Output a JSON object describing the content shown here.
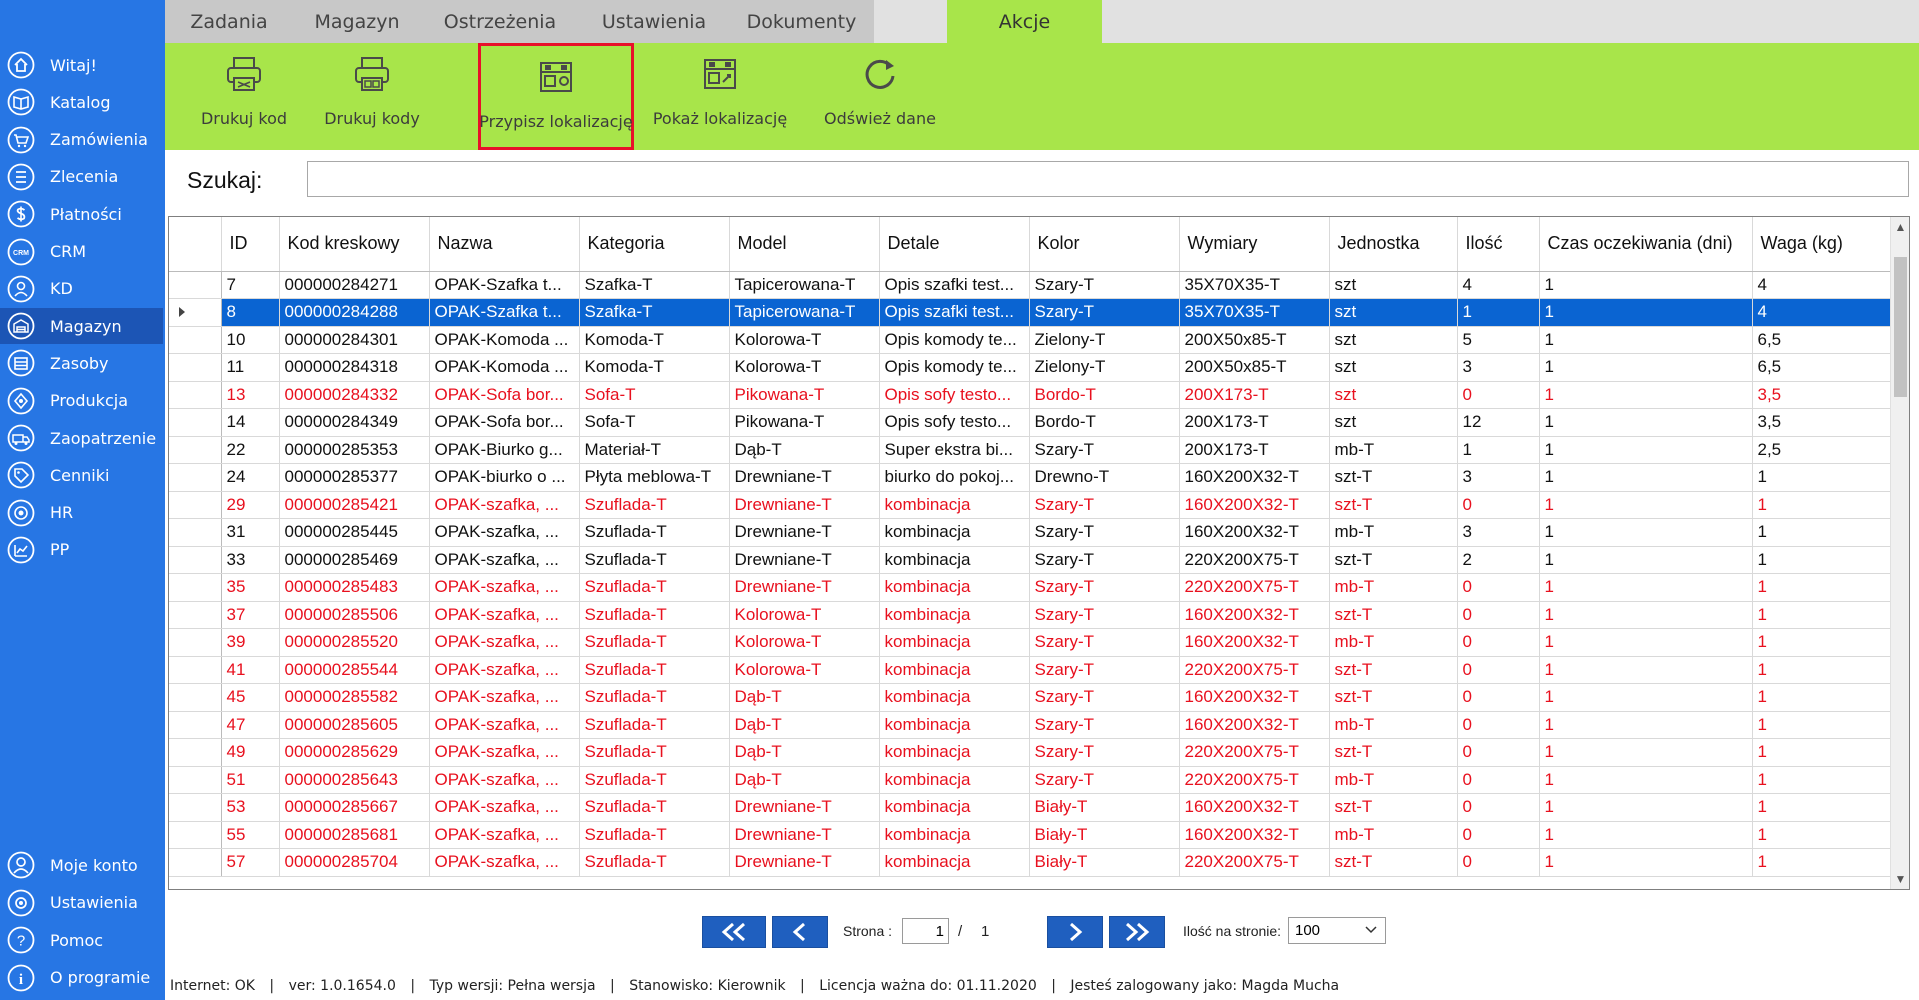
{
  "sidebar": {
    "items": [
      {
        "label": "Witaj!",
        "icon": "home-icon"
      },
      {
        "label": "Katalog",
        "icon": "book-icon"
      },
      {
        "label": "Zamówienia",
        "icon": "cart-icon"
      },
      {
        "label": "Zlecenia",
        "icon": "list-icon"
      },
      {
        "label": "Płatności",
        "icon": "dollar-icon"
      },
      {
        "label": "CRM",
        "icon": "crm-icon"
      },
      {
        "label": "KD",
        "icon": "user-icon"
      },
      {
        "label": "Magazyn",
        "icon": "warehouse-icon"
      },
      {
        "label": "Zasoby",
        "icon": "resources-icon"
      },
      {
        "label": "Produkcja",
        "icon": "production-icon"
      },
      {
        "label": "Zaopatrzenie",
        "icon": "truck-icon"
      },
      {
        "label": "Cenniki",
        "icon": "tag-icon"
      },
      {
        "label": "HR",
        "icon": "hr-icon"
      },
      {
        "label": "PP",
        "icon": "chart-icon"
      }
    ],
    "active_index": 7,
    "bottom_items": [
      {
        "label": "Moje konto",
        "icon": "account-icon"
      },
      {
        "label": "Ustawienia",
        "icon": "gear-icon"
      },
      {
        "label": "Pomoc",
        "icon": "help-icon"
      },
      {
        "label": "O programie",
        "icon": "info-icon"
      }
    ]
  },
  "tabs": [
    "Zadania",
    "Magazyn",
    "Ostrzeżenia",
    "Ustawienia",
    "Dokumenty",
    "Akcje"
  ],
  "active_tab": "Akcje",
  "ribbon": {
    "buttons": [
      {
        "label": "Drukuj kod",
        "icon": "printer-icon"
      },
      {
        "label": "Drukuj kody",
        "icon": "printer-multi-icon"
      },
      {
        "label": "Przypisz lokalizację",
        "icon": "assign-location-icon",
        "highlighted": true
      },
      {
        "label": "Pokaż lokalizację",
        "icon": "show-location-icon"
      },
      {
        "label": "Odśwież dane",
        "icon": "refresh-icon"
      }
    ]
  },
  "search": {
    "label": "Szukaj:",
    "value": ""
  },
  "grid": {
    "columns": [
      "ID",
      "Kod kreskowy",
      "Nazwa",
      "Kategoria",
      "Model",
      "Detale",
      "Kolor",
      "Wymiary",
      "Jednostka",
      "Ilość",
      "Czas oczekiwania (dni)",
      "Waga (kg)"
    ],
    "rows": [
      {
        "id": "7",
        "kod": "000000284271",
        "nazwa": "OPAK-Szafka t...",
        "kategoria": "Szafka-T",
        "model": "Tapicerowana-T",
        "detale": "Opis szafki test...",
        "kolor": "Szary-T",
        "wymiary": "35X70X35-T",
        "jednostka": "szt",
        "ilosc": "4",
        "czas": "1",
        "waga": "4",
        "state": "normal"
      },
      {
        "id": "8",
        "kod": "000000284288",
        "nazwa": "OPAK-Szafka t...",
        "kategoria": "Szafka-T",
        "model": "Tapicerowana-T",
        "detale": "Opis szafki test...",
        "kolor": "Szary-T",
        "wymiary": "35X70X35-T",
        "jednostka": "szt",
        "ilosc": "1",
        "czas": "1",
        "waga": "4",
        "state": "selected"
      },
      {
        "id": "10",
        "kod": "000000284301",
        "nazwa": "OPAK-Komoda ...",
        "kategoria": "Komoda-T",
        "model": "Kolorowa-T",
        "detale": "Opis komody te...",
        "kolor": "Zielony-T",
        "wymiary": "200X50x85-T",
        "jednostka": "szt",
        "ilosc": "5",
        "czas": "1",
        "waga": "6,5",
        "state": "normal"
      },
      {
        "id": "11",
        "kod": "000000284318",
        "nazwa": "OPAK-Komoda ...",
        "kategoria": "Komoda-T",
        "model": "Kolorowa-T",
        "detale": "Opis komody te...",
        "kolor": "Zielony-T",
        "wymiary": "200X50x85-T",
        "jednostka": "szt",
        "ilosc": "3",
        "czas": "1",
        "waga": "6,5",
        "state": "normal"
      },
      {
        "id": "13",
        "kod": "000000284332",
        "nazwa": "OPAK-Sofa bor...",
        "kategoria": "Sofa-T",
        "model": "Pikowana-T",
        "detale": "Opis sofy testo...",
        "kolor": "Bordo-T",
        "wymiary": "200X173-T",
        "jednostka": "szt",
        "ilosc": "0",
        "czas": "1",
        "waga": "3,5",
        "state": "alert"
      },
      {
        "id": "14",
        "kod": "000000284349",
        "nazwa": "OPAK-Sofa bor...",
        "kategoria": "Sofa-T",
        "model": "Pikowana-T",
        "detale": "Opis sofy testo...",
        "kolor": "Bordo-T",
        "wymiary": "200X173-T",
        "jednostka": "szt",
        "ilosc": "12",
        "czas": "1",
        "waga": "3,5",
        "state": "normal"
      },
      {
        "id": "22",
        "kod": "000000285353",
        "nazwa": "OPAK-Biurko g...",
        "kategoria": "Materiał-T",
        "model": "Dąb-T",
        "detale": "Super ekstra bi...",
        "kolor": "Szary-T",
        "wymiary": "200X173-T",
        "jednostka": "mb-T",
        "ilosc": "1",
        "czas": "1",
        "waga": "2,5",
        "state": "normal"
      },
      {
        "id": "24",
        "kod": "000000285377",
        "nazwa": "OPAK-biurko o ...",
        "kategoria": "Płyta meblowa-T",
        "model": "Drewniane-T",
        "detale": "biurko do pokoj...",
        "kolor": "Drewno-T",
        "wymiary": "160X200X32-T",
        "jednostka": "szt-T",
        "ilosc": "3",
        "czas": "1",
        "waga": "1",
        "state": "normal"
      },
      {
        "id": "29",
        "kod": "000000285421",
        "nazwa": "OPAK-szafka, ...",
        "kategoria": "Szuflada-T",
        "model": "Drewniane-T",
        "detale": "kombinacja",
        "kolor": "Szary-T",
        "wymiary": "160X200X32-T",
        "jednostka": "szt-T",
        "ilosc": "0",
        "czas": "1",
        "waga": "1",
        "state": "alert"
      },
      {
        "id": "31",
        "kod": "000000285445",
        "nazwa": "OPAK-szafka, ...",
        "kategoria": "Szuflada-T",
        "model": "Drewniane-T",
        "detale": "kombinacja",
        "kolor": "Szary-T",
        "wymiary": "160X200X32-T",
        "jednostka": "mb-T",
        "ilosc": "3",
        "czas": "1",
        "waga": "1",
        "state": "normal"
      },
      {
        "id": "33",
        "kod": "000000285469",
        "nazwa": "OPAK-szafka, ...",
        "kategoria": "Szuflada-T",
        "model": "Drewniane-T",
        "detale": "kombinacja",
        "kolor": "Szary-T",
        "wymiary": "220X200X75-T",
        "jednostka": "szt-T",
        "ilosc": "2",
        "czas": "1",
        "waga": "1",
        "state": "normal"
      },
      {
        "id": "35",
        "kod": "000000285483",
        "nazwa": "OPAK-szafka, ...",
        "kategoria": "Szuflada-T",
        "model": "Drewniane-T",
        "detale": "kombinacja",
        "kolor": "Szary-T",
        "wymiary": "220X200X75-T",
        "jednostka": "mb-T",
        "ilosc": "0",
        "czas": "1",
        "waga": "1",
        "state": "alert"
      },
      {
        "id": "37",
        "kod": "000000285506",
        "nazwa": "OPAK-szafka, ...",
        "kategoria": "Szuflada-T",
        "model": "Kolorowa-T",
        "detale": "kombinacja",
        "kolor": "Szary-T",
        "wymiary": "160X200X32-T",
        "jednostka": "szt-T",
        "ilosc": "0",
        "czas": "1",
        "waga": "1",
        "state": "alert"
      },
      {
        "id": "39",
        "kod": "000000285520",
        "nazwa": "OPAK-szafka, ...",
        "kategoria": "Szuflada-T",
        "model": "Kolorowa-T",
        "detale": "kombinacja",
        "kolor": "Szary-T",
        "wymiary": "160X200X32-T",
        "jednostka": "mb-T",
        "ilosc": "0",
        "czas": "1",
        "waga": "1",
        "state": "alert"
      },
      {
        "id": "41",
        "kod": "000000285544",
        "nazwa": "OPAK-szafka, ...",
        "kategoria": "Szuflada-T",
        "model": "Kolorowa-T",
        "detale": "kombinacja",
        "kolor": "Szary-T",
        "wymiary": "220X200X75-T",
        "jednostka": "szt-T",
        "ilosc": "0",
        "czas": "1",
        "waga": "1",
        "state": "alert"
      },
      {
        "id": "45",
        "kod": "000000285582",
        "nazwa": "OPAK-szafka, ...",
        "kategoria": "Szuflada-T",
        "model": "Dąb-T",
        "detale": "kombinacja",
        "kolor": "Szary-T",
        "wymiary": "160X200X32-T",
        "jednostka": "szt-T",
        "ilosc": "0",
        "czas": "1",
        "waga": "1",
        "state": "alert"
      },
      {
        "id": "47",
        "kod": "000000285605",
        "nazwa": "OPAK-szafka, ...",
        "kategoria": "Szuflada-T",
        "model": "Dąb-T",
        "detale": "kombinacja",
        "kolor": "Szary-T",
        "wymiary": "160X200X32-T",
        "jednostka": "mb-T",
        "ilosc": "0",
        "czas": "1",
        "waga": "1",
        "state": "alert"
      },
      {
        "id": "49",
        "kod": "000000285629",
        "nazwa": "OPAK-szafka, ...",
        "kategoria": "Szuflada-T",
        "model": "Dąb-T",
        "detale": "kombinacja",
        "kolor": "Szary-T",
        "wymiary": "220X200X75-T",
        "jednostka": "szt-T",
        "ilosc": "0",
        "czas": "1",
        "waga": "1",
        "state": "alert"
      },
      {
        "id": "51",
        "kod": "000000285643",
        "nazwa": "OPAK-szafka, ...",
        "kategoria": "Szuflada-T",
        "model": "Dąb-T",
        "detale": "kombinacja",
        "kolor": "Szary-T",
        "wymiary": "220X200X75-T",
        "jednostka": "mb-T",
        "ilosc": "0",
        "czas": "1",
        "waga": "1",
        "state": "alert"
      },
      {
        "id": "53",
        "kod": "000000285667",
        "nazwa": "OPAK-szafka, ...",
        "kategoria": "Szuflada-T",
        "model": "Drewniane-T",
        "detale": "kombinacja",
        "kolor": "Biały-T",
        "wymiary": "160X200X32-T",
        "jednostka": "szt-T",
        "ilosc": "0",
        "czas": "1",
        "waga": "1",
        "state": "alert"
      },
      {
        "id": "55",
        "kod": "000000285681",
        "nazwa": "OPAK-szafka, ...",
        "kategoria": "Szuflada-T",
        "model": "Drewniane-T",
        "detale": "kombinacja",
        "kolor": "Biały-T",
        "wymiary": "160X200X32-T",
        "jednostka": "mb-T",
        "ilosc": "0",
        "czas": "1",
        "waga": "1",
        "state": "alert"
      },
      {
        "id": "57",
        "kod": "000000285704",
        "nazwa": "OPAK-szafka, ...",
        "kategoria": "Szuflada-T",
        "model": "Drewniane-T",
        "detale": "kombinacja",
        "kolor": "Biały-T",
        "wymiary": "220X200X75-T",
        "jednostka": "szt-T",
        "ilosc": "0",
        "czas": "1",
        "waga": "1",
        "state": "alert"
      }
    ]
  },
  "pagination": {
    "first_icon": "double-chevron-left-icon",
    "prev_icon": "chevron-left-icon",
    "next_icon": "chevron-right-icon",
    "last_icon": "double-chevron-right-icon",
    "page_label": "Strona :",
    "current_page": "1",
    "separator": "/",
    "total_pages": "1",
    "per_page_label": "Ilość na stronie:",
    "per_page_value": "100"
  },
  "status": {
    "internet": "Internet: OK",
    "version": "ver: 1.0.1654.0",
    "version_type": "Typ wersji: Pełna wersja",
    "station": "Stanowisko: Kierownik",
    "license": "Licencja ważna do: 01.11.2020",
    "user": "Jesteś zalogowany jako: Magda Mucha",
    "separator": "|"
  },
  "colors": {
    "sidebar": "#2776e4",
    "sidebar_active": "#1c55b5",
    "ribbon": "#a8e54a",
    "selection": "#0a64d2",
    "alert_text": "#e8101e",
    "highlight_border": "#e8102a",
    "pager_button": "#1f5fbf"
  }
}
